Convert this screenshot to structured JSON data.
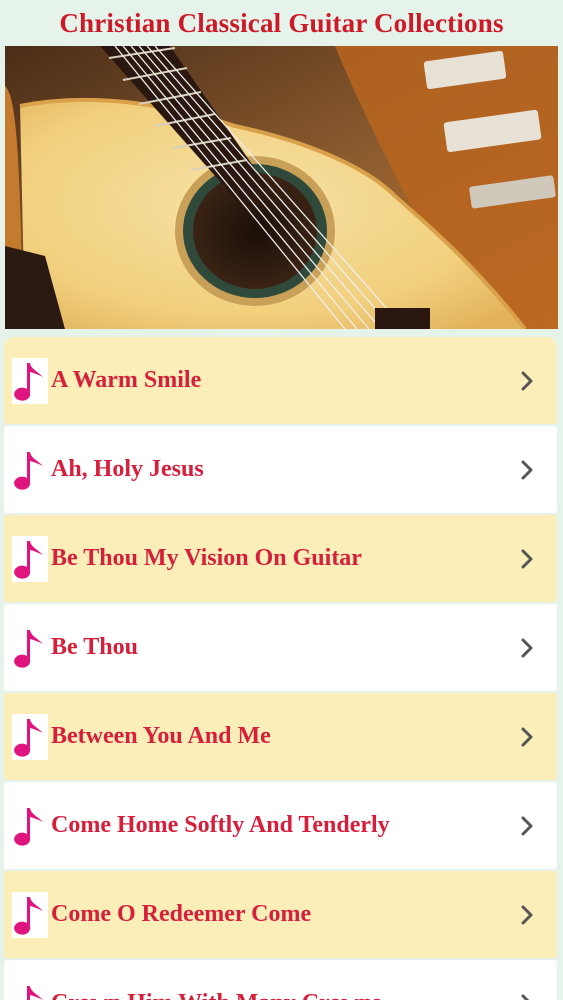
{
  "header": {
    "title": "Christian Classical Guitar Collections"
  },
  "banner": {
    "icon": "guitar-banner-image"
  },
  "colors": {
    "title": "#cc1a28",
    "item_text": "#d61f3b",
    "note_icon": "#e0147e",
    "odd_row": "#fbeeb8",
    "even_row": "#ffffff",
    "chevron": "#555555",
    "background": "#e6f3ea"
  },
  "songs": [
    {
      "label": "A Warm Smile"
    },
    {
      "label": "Ah, Holy Jesus"
    },
    {
      "label": "Be Thou My Vision On Guitar"
    },
    {
      "label": "Be Thou"
    },
    {
      "label": "Between You And Me"
    },
    {
      "label": "Come Home Softly And Tenderly"
    },
    {
      "label": "Come O Redeemer Come"
    },
    {
      "label": "Crown Him With Many Crowns"
    }
  ]
}
